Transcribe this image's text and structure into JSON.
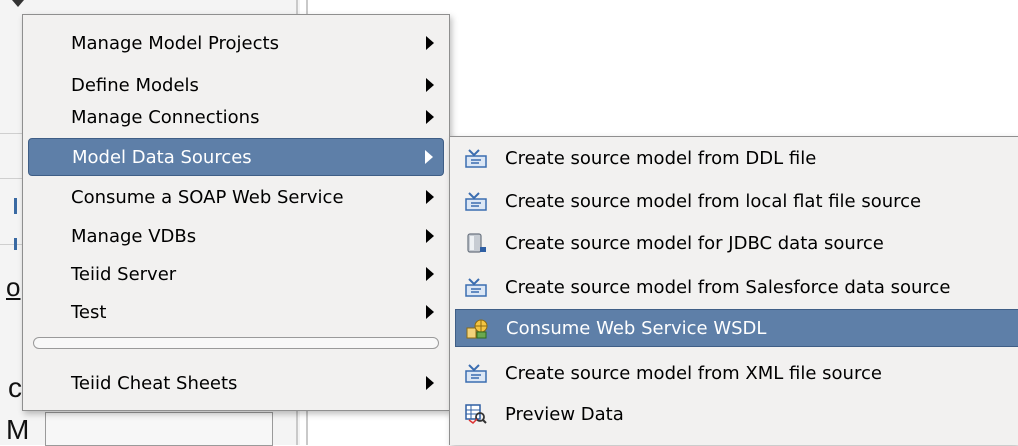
{
  "background": {
    "fragment_1": "o",
    "fragment_2": "c",
    "fragment_3": "M"
  },
  "main_menu": {
    "items": [
      {
        "label": "Manage Model Projects",
        "has_submenu": true
      },
      {
        "label": "Define Models",
        "has_submenu": true
      },
      {
        "label": "Manage Connections",
        "has_submenu": true
      },
      {
        "label": "Model Data Sources",
        "has_submenu": true,
        "selected": true
      },
      {
        "label": "Consume a SOAP Web Service",
        "has_submenu": true
      },
      {
        "label": "Manage VDBs",
        "has_submenu": true
      },
      {
        "label": "Teiid Server",
        "has_submenu": true
      },
      {
        "label": "Test",
        "has_submenu": true
      }
    ],
    "cheat_sheets": {
      "label": "Teiid Cheat Sheets",
      "has_submenu": true
    }
  },
  "submenu": {
    "items": [
      {
        "label": "Create source model from DDL file",
        "icon": "import-model-icon"
      },
      {
        "label": "Create source model from local flat file source",
        "icon": "import-model-icon"
      },
      {
        "label": "Create source model for JDBC data source",
        "icon": "database-icon"
      },
      {
        "label": "Create source model from Salesforce data source",
        "icon": "import-model-icon"
      },
      {
        "label": "Consume Web Service WSDL",
        "icon": "web-service-icon",
        "selected": true
      },
      {
        "label": "Create source model from XML file source",
        "icon": "import-model-icon"
      },
      {
        "label": "Preview Data",
        "icon": "preview-data-icon"
      }
    ]
  },
  "colors": {
    "selection": "#5e7fa8",
    "menu_background": "#f2f1f0"
  }
}
